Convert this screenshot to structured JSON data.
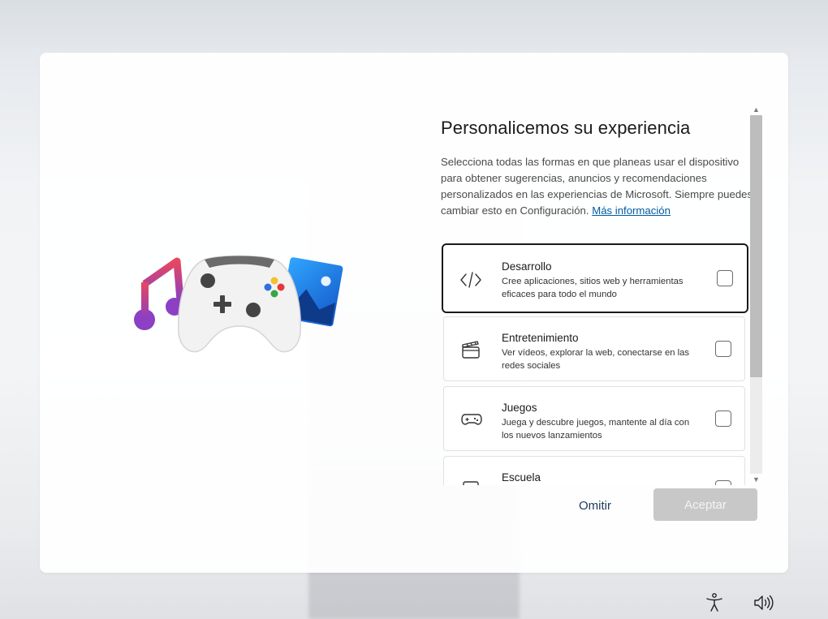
{
  "heading": "Personalicemos su experiencia",
  "description": "Selecciona todas las formas en que planeas usar el dispositivo para obtener sugerencias, anuncios y recomendaciones personalizados en las experiencias de Microsoft. Siempre puedes cambiar esto en Configuración.",
  "more_info_link": "Más información",
  "options": [
    {
      "title": "Desarrollo",
      "subtitle": "Cree aplicaciones, sitios web y herramientas eficaces para todo el mundo",
      "icon": "code-icon",
      "checked": false,
      "focused": true
    },
    {
      "title": "Entretenimiento",
      "subtitle": "Ver vídeos, explorar la web, conectarse en las redes sociales",
      "icon": "clapperboard-icon",
      "checked": false
    },
    {
      "title": "Juegos",
      "subtitle": "Juega y descubre juegos, mantente al día con los nuevos lanzamientos",
      "icon": "gamepad-icon",
      "checked": false
    },
    {
      "title": "Escuela",
      "subtitle": "",
      "icon": "school-icon",
      "checked": false
    }
  ],
  "buttons": {
    "skip": "Omitir",
    "accept": "Aceptar"
  },
  "tray": {
    "accessibility_icon": "accessibility-icon",
    "volume_icon": "volume-icon"
  },
  "colors": {
    "link": "#005a9e",
    "accept_disabled": "#c8c8c8",
    "focus_border": "#1a1a1a"
  }
}
